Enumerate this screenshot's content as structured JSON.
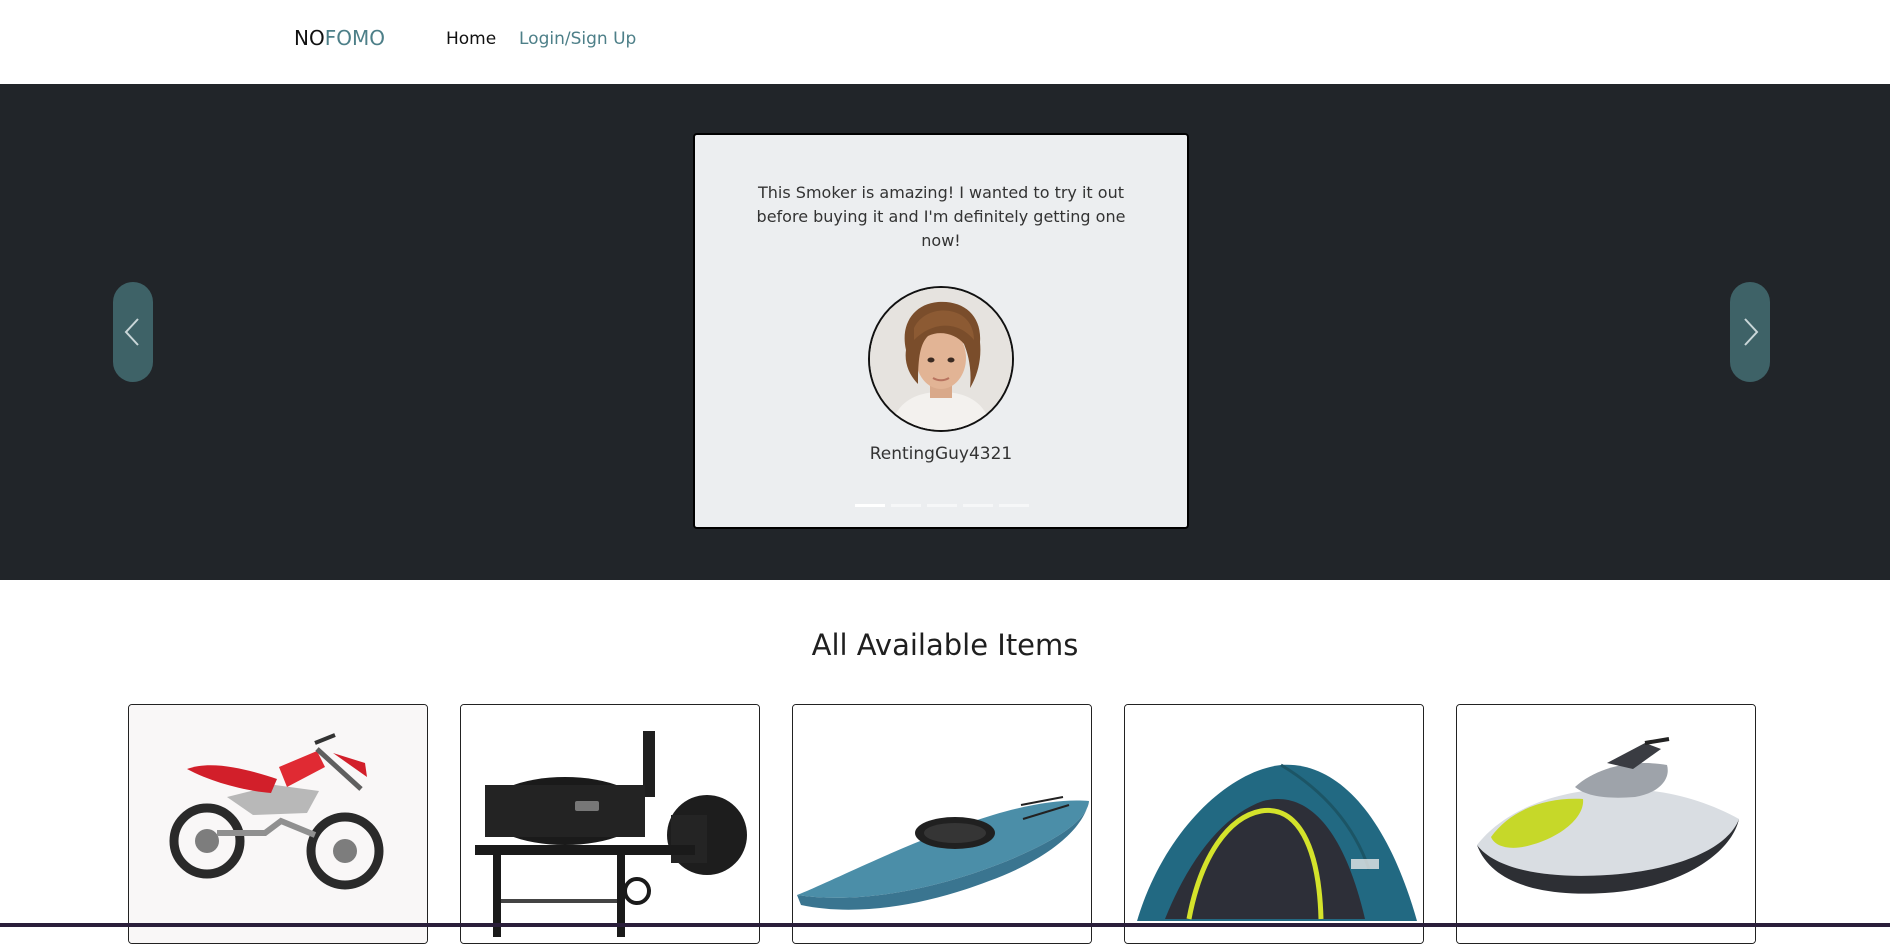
{
  "navbar": {
    "brand_no": "NO",
    "brand_fomo": "FOMO",
    "links": [
      "Home",
      "Login/Sign Up"
    ]
  },
  "carousel": {
    "prev_icon": "chevron-left-icon",
    "next_icon": "chevron-right-icon",
    "active_slide": 1,
    "slide_count": 5,
    "testimonial": {
      "quote": "This Smoker is amazing! I wanted to try it out before buying it and I'm definitely getting one now!",
      "name": "RentingGuy4321"
    }
  },
  "items_section": {
    "title": "All Available Items",
    "items": [
      "dirt bike",
      "smoker grill",
      "kayak",
      "tent",
      "jet ski"
    ]
  },
  "colors": {
    "accent": "#4d7f88",
    "hero_bg": "#212529",
    "card_bg": "#eceef0",
    "carousel_button": "#3e6267"
  }
}
